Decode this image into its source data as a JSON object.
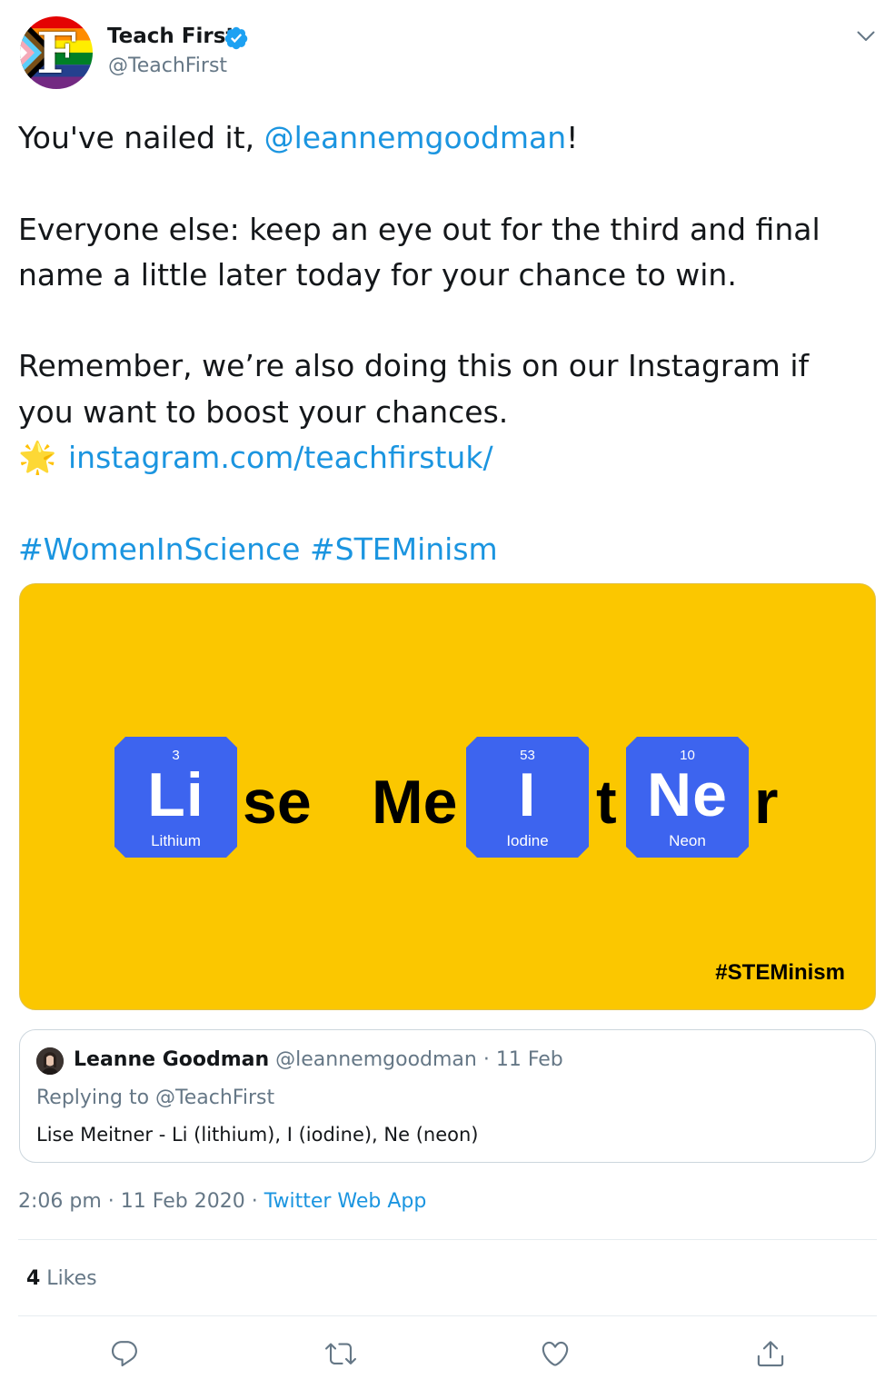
{
  "author": {
    "name": "Teach First",
    "handle": "@TeachFirst",
    "avatar_letter": "F",
    "verified": true
  },
  "tweet": {
    "line1_prefix": "You've nailed it, ",
    "mention": "@leannemgoodman",
    "line1_suffix": "!",
    "para2": "Everyone else: keep an eye out for the third and final name a little later today for your chance to win.",
    "para3": "Remember, we’re also doing this on our Instagram if you want to boost your chances.",
    "star_icon": "🌟",
    "link": "instagram.com/teachfirstuk/",
    "hashtag1": "#WomenInScience",
    "hashtag2": "#STEMinism"
  },
  "media": {
    "background": "#fbc700",
    "tile_color": "#3d64ef",
    "elements": [
      {
        "number": "3",
        "symbol": "Li",
        "name": "Lithium"
      },
      {
        "number": "53",
        "symbol": "I",
        "name": "Iodine"
      },
      {
        "number": "10",
        "symbol": "Ne",
        "name": "Neon"
      }
    ],
    "word_se": "se",
    "word_me": "Me",
    "word_t": "t",
    "word_r": "r",
    "tag": "#STEMinism"
  },
  "quote": {
    "name": "Leanne Goodman",
    "handle": "@leannemgoodman",
    "date": "11 Feb",
    "separator": " · ",
    "replying": "Replying to @TeachFirst",
    "text": "Lise Meitner - Li (lithium), I (iodine), Ne (neon)"
  },
  "meta": {
    "time": "2:06 pm",
    "date": "11 Feb 2020",
    "separator": " · ",
    "source": "Twitter Web App"
  },
  "stats": {
    "likes_count": "4",
    "likes_label": " Likes"
  },
  "actions": {
    "icons": [
      "reply-icon",
      "retweet-icon",
      "like-icon",
      "share-icon"
    ]
  },
  "colors": {
    "link": "#1b95e0",
    "secondary": "#657786",
    "verified": "#1da1f2"
  }
}
